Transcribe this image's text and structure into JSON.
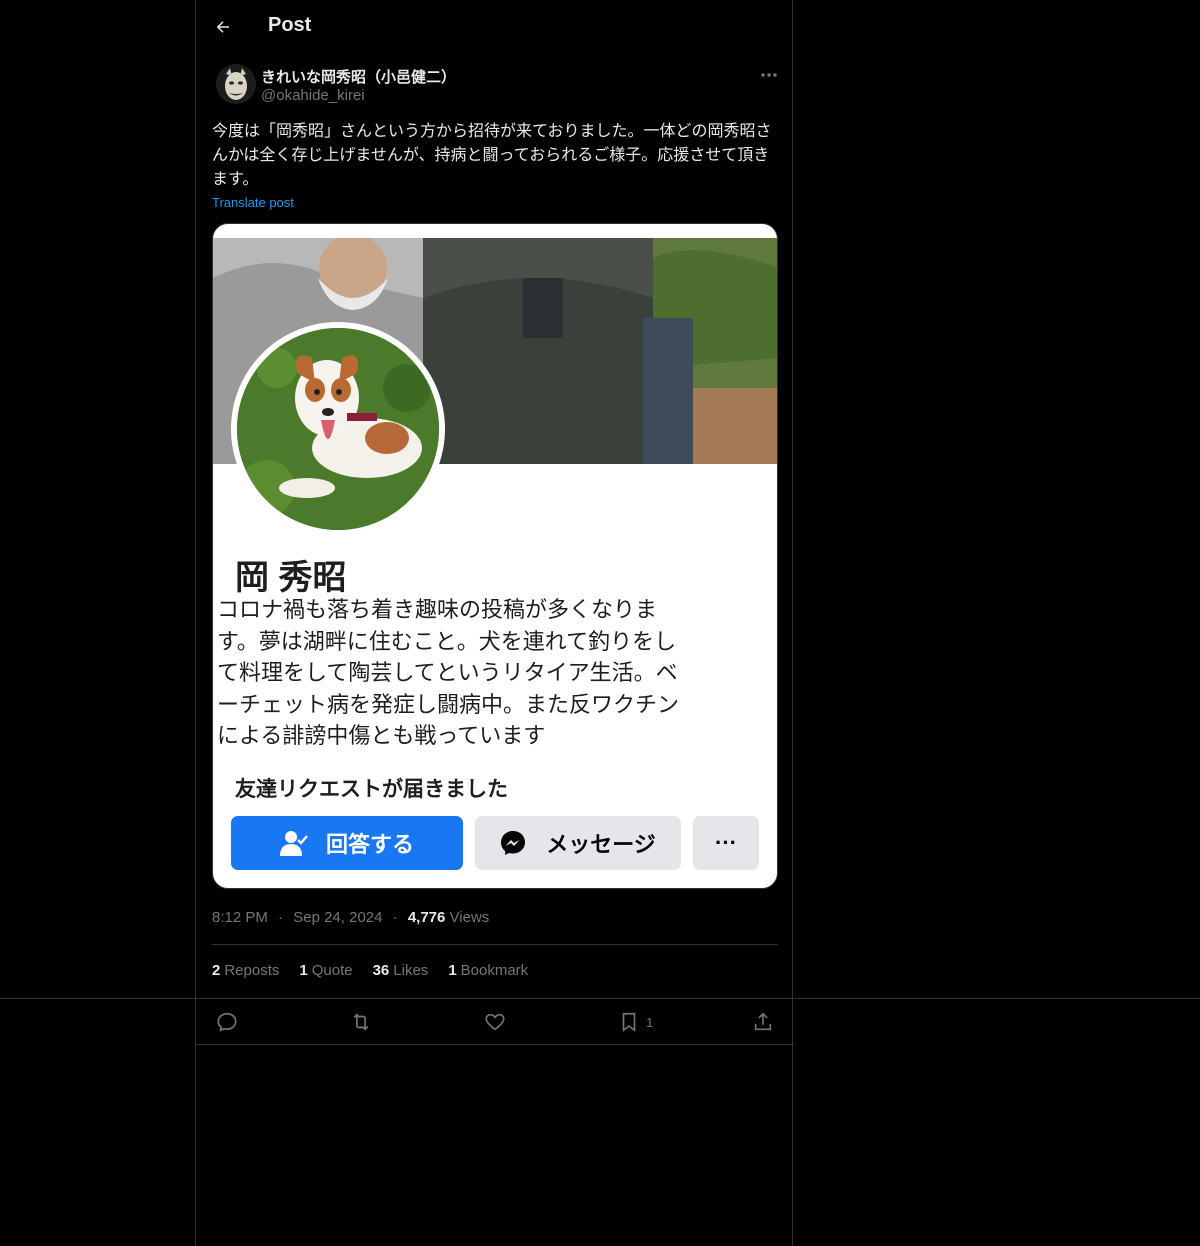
{
  "header": {
    "title": "Post"
  },
  "author": {
    "display_name": "きれいな岡秀昭（小邑健二）",
    "handle": "@okahide_kirei"
  },
  "post": {
    "text": "今度は「岡秀昭」さんという方から招待が来ておりました。一体どの岡秀昭さんかは全く存じ上げませんが、持病と闘っておられるご様子。応援させて頂きます。",
    "translate_label": "Translate post"
  },
  "media": {
    "name": "岡 秀昭",
    "bio": "コロナ禍も落ち着き趣味の投稿が多くなります。夢は湖畔に住むこと。犬を連れて釣りをして料理をして陶芸してというリタイア生活。ベーチェット病を発症し闘病中。また反ワクチンによる誹謗中傷とも戦っています",
    "request_text": "友達リクエストが届きました",
    "answer_button": "回答する",
    "message_button": "メッセージ",
    "more_button": "···"
  },
  "meta": {
    "time": "8:12 PM",
    "separator": "·",
    "date": "Sep 24, 2024",
    "views_count": "4,776",
    "views_label": "Views"
  },
  "stats": {
    "reposts_count": "2",
    "reposts_label": "Reposts",
    "quote_count": "1",
    "quote_label": "Quote",
    "likes_count": "36",
    "likes_label": "Likes",
    "bookmark_count": "1",
    "bookmark_label": "Bookmark"
  },
  "actions": {
    "bookmark_count": "1"
  },
  "colors": {
    "background": "#000000",
    "text": "#e7e9ea",
    "muted": "#71767b",
    "link": "#1d9bf0",
    "border": "#2f3336",
    "fb_blue": "#1877f2"
  }
}
